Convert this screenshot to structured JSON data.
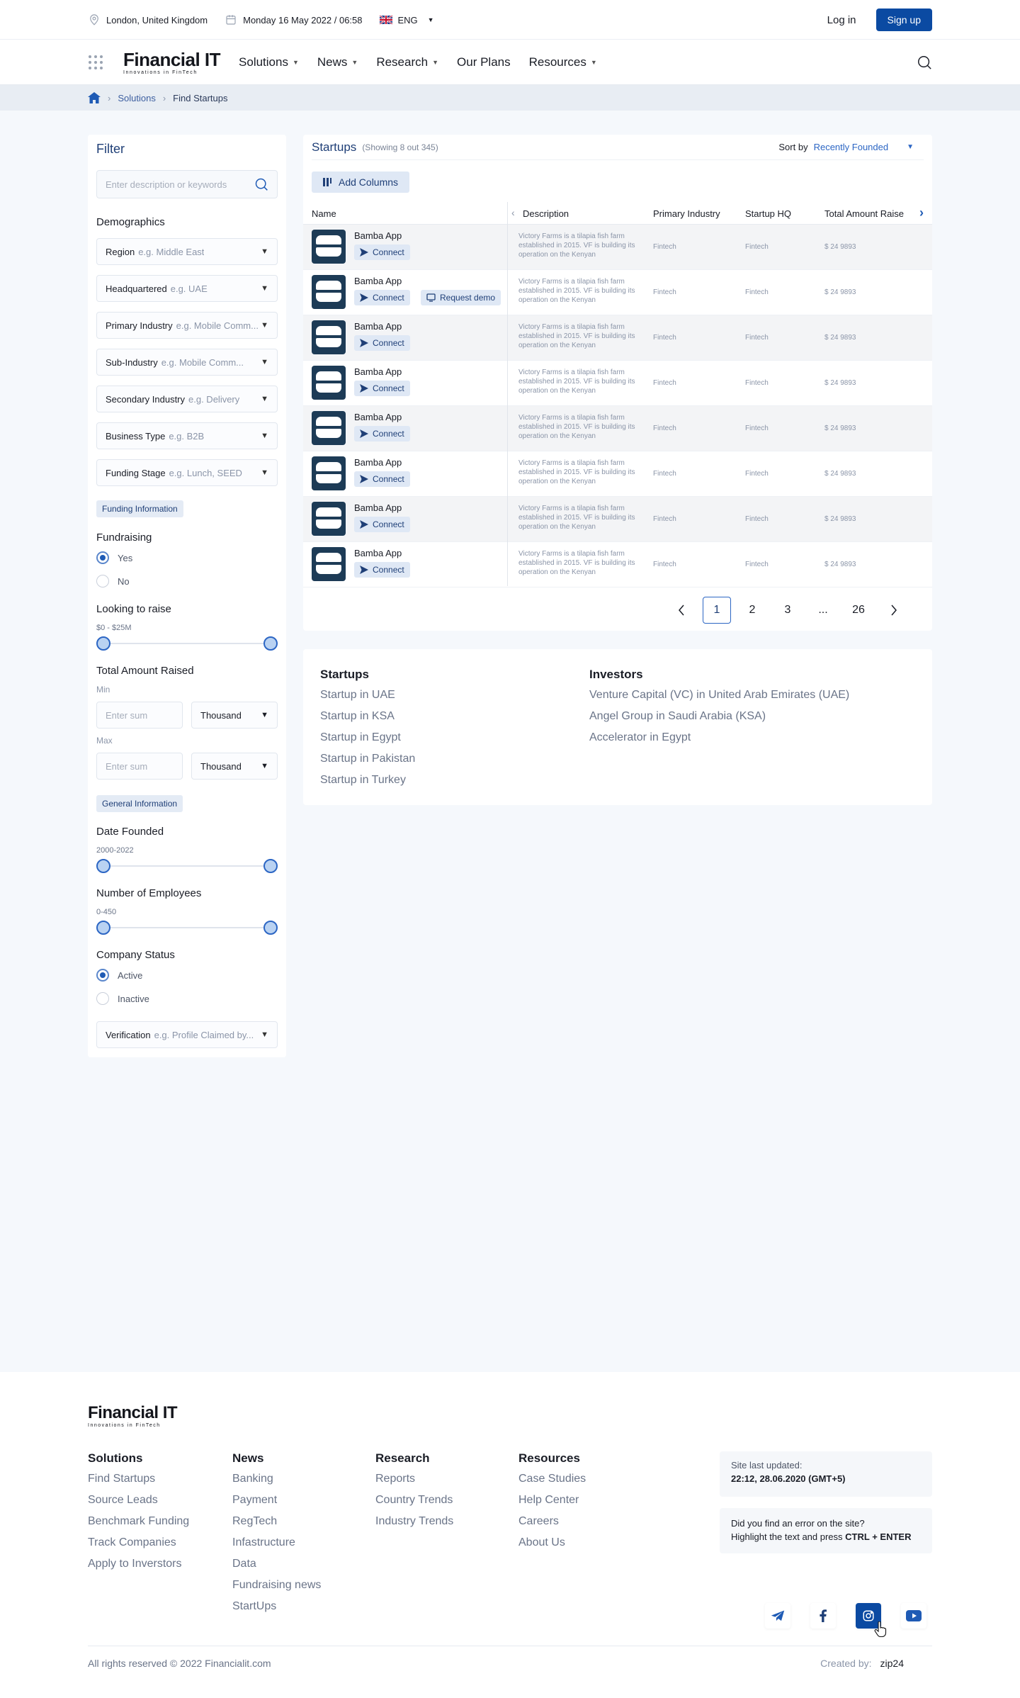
{
  "topbar": {
    "location": "London, United Kingdom",
    "datetime": "Monday 16 May 2022 / 06:58",
    "language": "ENG",
    "login": "Log in",
    "signup": "Sign up"
  },
  "brand": {
    "name": "Financial IT",
    "tagline": "Innovations in FinTech"
  },
  "nav": [
    {
      "label": "Solutions",
      "dropdown": true
    },
    {
      "label": "News",
      "dropdown": true
    },
    {
      "label": "Research",
      "dropdown": true
    },
    {
      "label": "Our Plans",
      "dropdown": false
    },
    {
      "label": "Resources",
      "dropdown": true
    }
  ],
  "breadcrumb": {
    "level1": "Solutions",
    "current": "Find Startups"
  },
  "filter": {
    "title": "Filter",
    "search_placeholder": "Enter description or keywords",
    "demographics": "Demographics",
    "dropdowns": [
      {
        "label": "Region",
        "placeholder": "e.g. Middle East"
      },
      {
        "label": "Headquartered",
        "placeholder": "e.g. UAE"
      },
      {
        "label": "Primary Industry",
        "placeholder": "e.g. Mobile Comm..."
      },
      {
        "label": "Sub-Industry",
        "placeholder": "e.g. Mobile Comm..."
      },
      {
        "label": "Secondary Industry",
        "placeholder": "e.g. Delivery"
      },
      {
        "label": "Business Type",
        "placeholder": "e.g. B2B"
      },
      {
        "label": "Funding Stage",
        "placeholder": "e.g. Lunch, SEED"
      }
    ],
    "funding_info": "Funding Information",
    "fundraising": {
      "label": "Fundraising",
      "options": [
        "Yes",
        "No"
      ],
      "selected": "Yes"
    },
    "looking_to_raise": {
      "label": "Looking to raise",
      "range": "$0 - $25M",
      "min_fraction": 0,
      "max_fraction": 1
    },
    "total_amount_raised": {
      "label": "Total Amount Raised",
      "min_label": "Min",
      "max_label": "Max",
      "sum_placeholder": "Enter sum",
      "unit": "Thousand"
    },
    "general_info": "General Information",
    "date_founded": {
      "label": "Date Founded",
      "range": "2000-2022",
      "min_fraction": 0,
      "max_fraction": 1
    },
    "employees": {
      "label": "Number of Employees",
      "range": "0-450",
      "min_fraction": 0,
      "max_fraction": 1
    },
    "company_status": {
      "label": "Company Status",
      "options": [
        "Active",
        "Inactive"
      ],
      "selected": "Active"
    },
    "verification": {
      "label": "Verification",
      "placeholder": "e.g. Profile Claimed by..."
    }
  },
  "startups": {
    "title": "Startups",
    "count": "(Showing 8 out 345)",
    "sort_label": "Sort by",
    "sort_value": "Recently Founded",
    "add_columns": "Add Columns",
    "columns": [
      "Name",
      "Description",
      "Primary Industry",
      "Startup HQ",
      "Total Amount Raise"
    ],
    "connect_label": "Connect",
    "demo_label": "Request demo",
    "rows": [
      {
        "name": "Bamba App",
        "description": "Victory Farms is a tilapia fish farm established in 2015. VF is building its operation on the Kenyan",
        "industry": "Fintech",
        "hq": "Fintech",
        "raised": "$ 24 9893",
        "demo": false
      },
      {
        "name": "Bamba App",
        "description": "Victory Farms is a tilapia fish farm established in 2015. VF is building its operation on the Kenyan",
        "industry": "Fintech",
        "hq": "Fintech",
        "raised": "$ 24 9893",
        "demo": true
      },
      {
        "name": "Bamba App",
        "description": "Victory Farms is a tilapia fish farm established in 2015. VF is building its operation on the Kenyan",
        "industry": "Fintech",
        "hq": "Fintech",
        "raised": "$ 24 9893",
        "demo": false
      },
      {
        "name": "Bamba App",
        "description": "Victory Farms is a tilapia fish farm established in 2015. VF is building its operation on the Kenyan",
        "industry": "Fintech",
        "hq": "Fintech",
        "raised": "$ 24 9893",
        "demo": false
      },
      {
        "name": "Bamba App",
        "description": "Victory Farms is a tilapia fish farm established in 2015. VF is building its operation on the Kenyan",
        "industry": "Fintech",
        "hq": "Fintech",
        "raised": "$ 24 9893",
        "demo": false
      },
      {
        "name": "Bamba App",
        "description": "Victory Farms is a tilapia fish farm established in 2015. VF is building its operation on the Kenyan",
        "industry": "Fintech",
        "hq": "Fintech",
        "raised": "$ 24 9893",
        "demo": false
      },
      {
        "name": "Bamba App",
        "description": "Victory Farms is a tilapia fish farm established in 2015. VF is building its operation on the Kenyan",
        "industry": "Fintech",
        "hq": "Fintech",
        "raised": "$ 24 9893",
        "demo": false
      },
      {
        "name": "Bamba App",
        "description": "Victory Farms is a tilapia fish farm established in 2015. VF is building its operation on the Kenyan",
        "industry": "Fintech",
        "hq": "Fintech",
        "raised": "$ 24 9893",
        "demo": false
      }
    ],
    "pagination": {
      "pages": [
        "1",
        "2",
        "3",
        "...",
        "26"
      ],
      "current": "1"
    }
  },
  "related": {
    "startups_title": "Startups",
    "startups": [
      "Startup in UAE",
      "Startup in KSA",
      "Startup in Egypt",
      "Startup in Pakistan",
      "Startup in Turkey"
    ],
    "investors_title": "Investors",
    "investors": [
      "Venture Capital (VC) in United Arab Emirates (UAE)",
      "Angel Group in Saudi Arabia (KSA)",
      "Accelerator in Egypt"
    ]
  },
  "footer": {
    "columns": [
      {
        "title": "Solutions",
        "links": [
          "Find Startups",
          "Source Leads",
          "Benchmark Funding",
          "Track Companies",
          "Apply to Inverstors"
        ]
      },
      {
        "title": "News",
        "links": [
          "Banking",
          "Payment",
          "RegTech",
          "Infastructure",
          "Data",
          "Fundraising news",
          "StartUps"
        ]
      },
      {
        "title": "Research",
        "links": [
          "Reports",
          "Country Trends",
          "Industry Trends"
        ]
      },
      {
        "title": "Resources",
        "links": [
          "Case Studies",
          "Help Center",
          "Careers",
          "About Us"
        ]
      }
    ],
    "updated_label": "Site last updated:",
    "updated_value": "22:12, 28.06.2020 (GMT+5)",
    "error_line1": "Did you find an error on the site?",
    "error_line2": "Highlight the text and press ",
    "error_keys": "CTRL + ENTER",
    "social": [
      "telegram-icon",
      "facebook-icon",
      "instagram-icon",
      "youtube-icon"
    ],
    "copyright": "All rights reserved © 2022 Financialit.com",
    "created_label": "Created by:",
    "created_by": "zip24"
  },
  "colors": {
    "accent": "#0b4aa2",
    "link": "#2c66c4",
    "bg": "#f5f8fc"
  }
}
